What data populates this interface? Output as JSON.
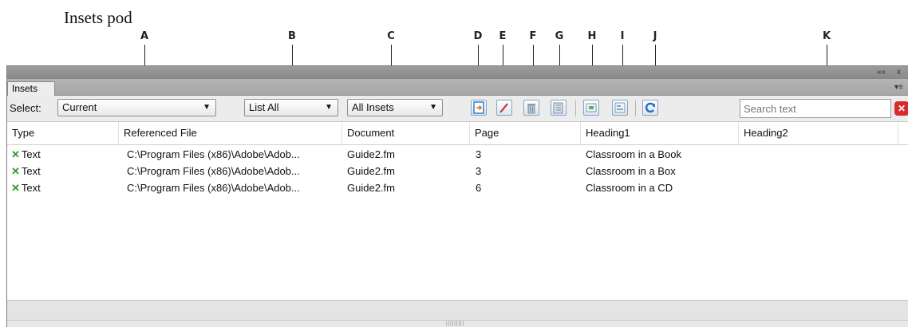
{
  "figure": {
    "title": "Insets pod",
    "callouts": [
      "A",
      "B",
      "C",
      "D",
      "E",
      "F",
      "G",
      "H",
      "I",
      "J",
      "K"
    ]
  },
  "panel": {
    "tab_label": "Insets",
    "collapse_glyph": "««",
    "close_glyph": "x",
    "menu_glyph": "▾≡",
    "toolbar": {
      "select_label": "Select:",
      "scope_value": "Current",
      "list_value": "List All",
      "filter_value": "All Insets",
      "search_placeholder": "Search text",
      "dropdown_arrow": "▼"
    },
    "buttons": [
      {
        "name": "import-inset-button",
        "icon": "import-icon"
      },
      {
        "name": "edit-inset-button",
        "icon": "pencil-icon"
      },
      {
        "name": "delete-inset-button",
        "icon": "trash-icon"
      },
      {
        "name": "delete-all-button",
        "icon": "trash-list-icon"
      },
      {
        "name": "convert-button",
        "icon": "convert-icon"
      },
      {
        "name": "update-properties-button",
        "icon": "properties-icon"
      },
      {
        "name": "refresh-button",
        "icon": "refresh-icon"
      }
    ],
    "columns": [
      "Type",
      "Referenced File",
      "Document",
      "Page",
      "Heading1",
      "Heading2"
    ],
    "rows": [
      {
        "type": "Text",
        "file": "C:\\Program Files (x86)\\Adobe\\Adob...",
        "document": "Guide2.fm",
        "page": "3",
        "heading1": "Classroom in a Book",
        "heading2": ""
      },
      {
        "type": "Text",
        "file": "C:\\Program Files (x86)\\Adobe\\Adob...",
        "document": "Guide2.fm",
        "page": "3",
        "heading1": "Classroom in a Box",
        "heading2": ""
      },
      {
        "type": "Text",
        "file": "C:\\Program Files (x86)\\Adobe\\Adob...",
        "document": "Guide2.fm",
        "page": "6",
        "heading1": "Classroom in a CD",
        "heading2": ""
      }
    ],
    "type_icon_glyph": "✕",
    "grip_glyph": "|||||||||"
  },
  "colors": {
    "accent_blue": "#2a7fd4",
    "type_icon_green": "#2f9a2f",
    "clear_red": "#d62b2b"
  }
}
